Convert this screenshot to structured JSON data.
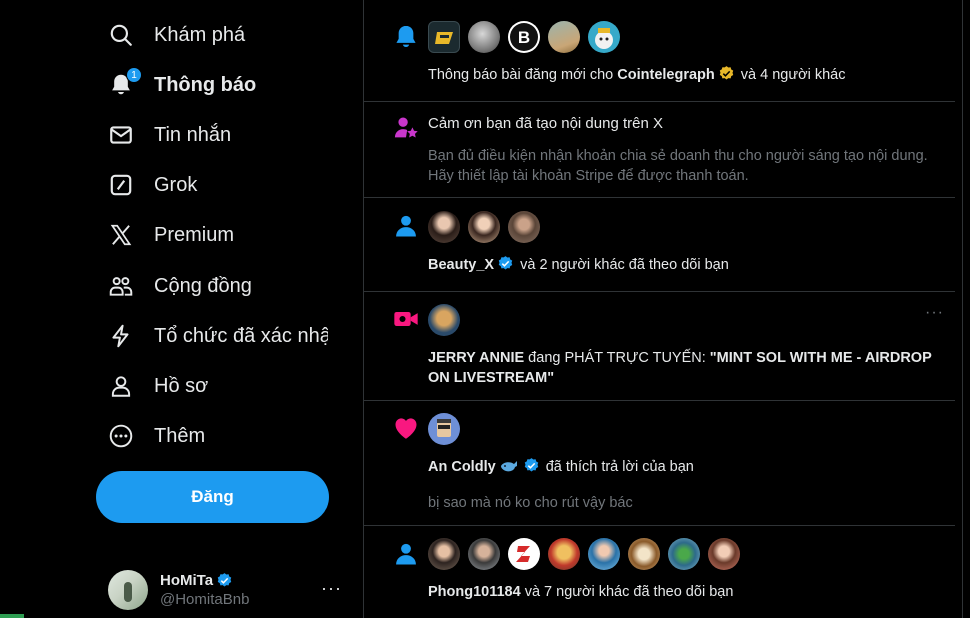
{
  "sidebar": {
    "items": [
      {
        "label": "Khám phá",
        "icon": "search-icon"
      },
      {
        "label": "Thông báo",
        "icon": "bell-icon",
        "badge": "1"
      },
      {
        "label": "Tin nhắn",
        "icon": "envelope-icon"
      },
      {
        "label": "Grok",
        "icon": "grok-icon"
      },
      {
        "label": "Premium",
        "icon": "x-logo-icon"
      },
      {
        "label": "Cộng đồng",
        "icon": "people-icon"
      },
      {
        "label": "Tổ chức đã xác nhậ",
        "icon": "lightning-icon"
      },
      {
        "label": "Hồ sơ",
        "icon": "person-icon"
      },
      {
        "label": "Thêm",
        "icon": "more-circle-icon"
      }
    ],
    "post_button": "Đăng",
    "account": {
      "name": "HoMiTa",
      "handle": "@HomitaBnb",
      "more": "···"
    }
  },
  "colors": {
    "accent": "#1d9bf0",
    "gold": "#e8b829",
    "pink": "#f91880",
    "purple": "#c936cc",
    "muted": "#71767b"
  },
  "notifications": [
    {
      "type_icon": "bell-notification-icon",
      "pre": "Thông báo bài đăng mới cho ",
      "name": "Cointelegraph",
      "post": " và 4 người khác"
    },
    {
      "type_icon": "creator-star-icon",
      "title": "Cảm ơn bạn đã tạo nội dung trên X",
      "body": "Bạn đủ điều kiện nhận khoản chia sẻ doanh thu cho người sáng tạo nội dung. Hãy thiết lập tài khoản Stripe để được thanh toán."
    },
    {
      "type_icon": "follow-person-icon",
      "name": "Beauty_X",
      "post": " và 2 người khác đã theo dõi bạn"
    },
    {
      "type_icon": "live-video-icon",
      "name": "JERRY ANNIE",
      "mid": " đang PHÁT TRỰC TUYẾN: ",
      "title": "\"MINT SOL WITH ME - AIRDROP ON LIVESTREAM\"",
      "more": "···"
    },
    {
      "type_icon": "heart-icon",
      "name": "An Coldly",
      "post": " đã thích trả lời của bạn",
      "reply": "bị sao mà nó ko cho rút vậy bác"
    },
    {
      "type_icon": "follow-person-icon",
      "name": "Phong101184",
      "post": " và 7 người khác đã theo dõi bạn"
    }
  ]
}
